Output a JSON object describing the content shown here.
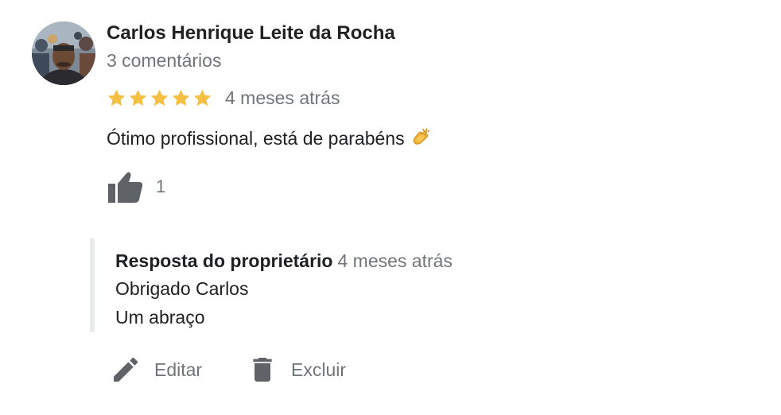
{
  "review": {
    "author_name": "Carlos Henrique Leite da Rocha",
    "author_meta": "3 comentários",
    "rating": 5,
    "rating_max": 5,
    "date": "4 meses atrás",
    "text": "Ótimo profissional, está de parabéns",
    "emoji_icon": "clapping-hands-icon",
    "likes": "1"
  },
  "owner_reply": {
    "title": "Resposta do proprietário",
    "date": "4 meses atrás",
    "lines": [
      "Obrigado Carlos",
      "Um abraço"
    ]
  },
  "actions": {
    "edit_label": "Editar",
    "delete_label": "Excluir"
  },
  "colors": {
    "star": "#f4bf42",
    "icon": "#5f6368",
    "muted_text": "#70757a",
    "reply_border": "#e8eaed"
  }
}
